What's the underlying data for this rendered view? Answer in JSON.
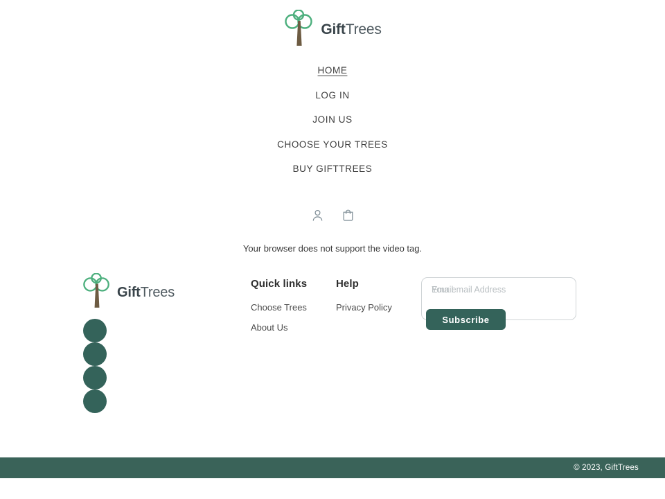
{
  "brand": {
    "name_bold": "Gift",
    "name_light": "Trees",
    "logo_icon": "tree-logo-icon",
    "leaf_color": "#4caf7d",
    "trunk_color": "#6d5b42"
  },
  "header": {
    "nav": [
      {
        "label": "HOME",
        "name": "nav-link-home",
        "active": true
      },
      {
        "label": "LOG IN",
        "name": "nav-link-log-in",
        "active": false
      },
      {
        "label": "JOIN US",
        "name": "nav-link-join-us",
        "active": false
      },
      {
        "label": "CHOOSE YOUR TREES",
        "name": "nav-link-choose-your-trees",
        "active": false
      },
      {
        "label": "BUY GIFTTREES",
        "name": "nav-link-buy-gifttrees",
        "active": false
      }
    ],
    "icons": [
      {
        "name": "account-icon",
        "label": "Account"
      },
      {
        "name": "shopping-bag-icon",
        "label": "Cart"
      }
    ]
  },
  "main": {
    "video_fallback_text": "Your browser does not support the video tag."
  },
  "footer": {
    "social": {
      "count": 4,
      "color": "#34635a",
      "items": [
        {
          "name": "social-icon-1"
        },
        {
          "name": "social-icon-2"
        },
        {
          "name": "social-icon-3"
        },
        {
          "name": "social-icon-4"
        }
      ]
    },
    "columns": [
      {
        "title": "Quick links",
        "name": "footer-column-quick-links",
        "links": [
          {
            "label": "Choose Trees",
            "name": "footer-link-choose-trees"
          },
          {
            "label": "About Us",
            "name": "footer-link-about-us"
          }
        ]
      },
      {
        "title": "Help",
        "name": "footer-column-help",
        "links": [
          {
            "label": "Privacy Policy",
            "name": "footer-link-privacy-policy"
          }
        ]
      }
    ],
    "newsletter": {
      "label": "Email",
      "placeholder": "Your email Address",
      "value": "",
      "button_label": "Subscribe",
      "button_color": "#34635a"
    },
    "copyright": "© 2023, GiftTrees",
    "bar_color": "#3a6359"
  }
}
